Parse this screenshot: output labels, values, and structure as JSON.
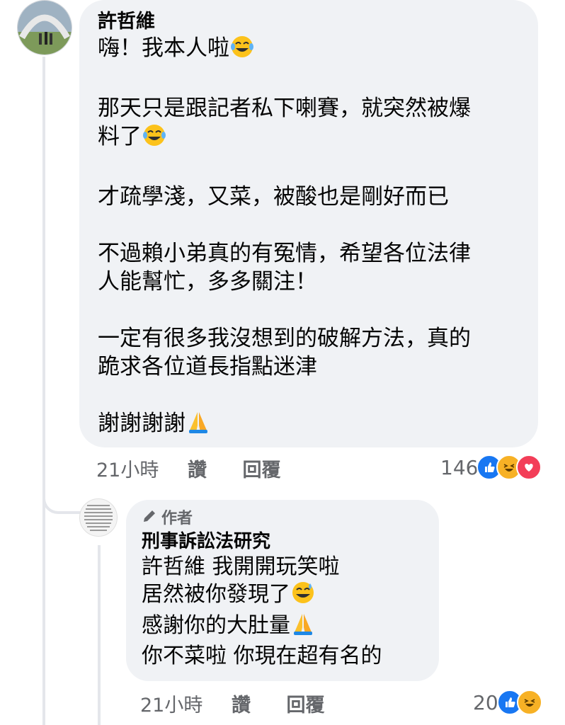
{
  "comment": {
    "author": "許哲維",
    "paragraphs": [
      "嗨！我本人啦",
      "那天只是跟記者私下喇賽，就突然被爆\n料了",
      "才疏學淺，又菜，被酸也是剛好而已",
      "不過賴小弟真的有冤情，希望各位法律\n人能幫忙，多多關注！",
      "一定有很多我沒想到的破解方法，真的\n跪求各位道長指點迷津",
      "謝謝謝謝"
    ],
    "emojis": [
      "joy-emoji",
      "joy-emoji",
      "folded-hands-emoji"
    ],
    "time": "21小時",
    "like_label": "讚",
    "reply_label": "回覆",
    "reaction_count": "146",
    "reactions": [
      "like",
      "haha",
      "love"
    ]
  },
  "reply": {
    "badge": "作者",
    "author": "刑事訴訟法研究",
    "lines": [
      "許哲維 我開開玩笑啦",
      "居然被你發現了",
      "感謝你的大肚量",
      "你不菜啦 你現在超有名的"
    ],
    "emojis": [
      "sweat-smile-emoji",
      "folded-hands-emoji"
    ],
    "time": "21小時",
    "like_label": "讚",
    "reply_label": "回覆",
    "reaction_count": "20",
    "reactions": [
      "like",
      "haha"
    ]
  },
  "colors": {
    "bubble": "#f0f2f5",
    "meta_text": "#65676b",
    "like_blue": "#1877f2",
    "haha_yellow": "#f7b125",
    "love_red": "#f33e58"
  }
}
